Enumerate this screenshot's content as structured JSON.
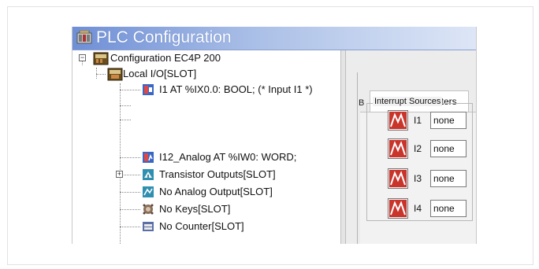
{
  "window": {
    "title": "PLC Configuration"
  },
  "tree": {
    "root_label": "Configuration EC4P  200",
    "local_io_label": "Local I/O[SLOT]",
    "items": [
      {
        "label": "I1 AT %IX0.0: BOOL; (* Input I1 *)",
        "icon": "digital-input-icon"
      },
      {
        "label": "I12_Analog AT %IW0: WORD;",
        "icon": "analog-input-icon"
      },
      {
        "label": "Transistor Outputs[SLOT]",
        "icon": "transistor-output-icon"
      },
      {
        "label": "No Analog Output[SLOT]",
        "icon": "analog-output-icon"
      },
      {
        "label": "No Keys[SLOT]",
        "icon": "keys-icon"
      },
      {
        "label": "No Counter[SLOT]",
        "icon": "counter-icon"
      }
    ]
  },
  "panel": {
    "tab_b": "B",
    "tab_other": "Other Parameters",
    "group_title": "Interrupt Sources",
    "interrupts": [
      {
        "label": "I1",
        "value": "none"
      },
      {
        "label": "I2",
        "value": "none"
      },
      {
        "label": "I3",
        "value": "none"
      },
      {
        "label": "I4",
        "value": "none"
      }
    ]
  }
}
